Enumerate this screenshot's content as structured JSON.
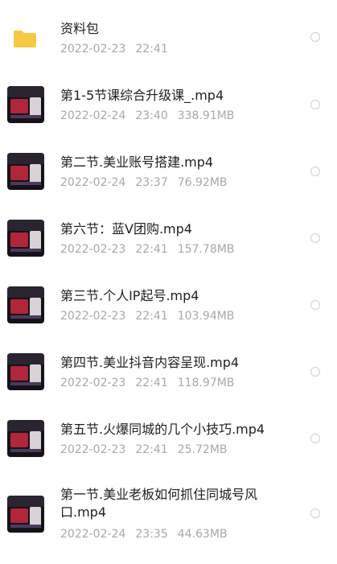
{
  "files": [
    {
      "name": "资料包",
      "date": "2022-02-23",
      "time": "22:41",
      "size": "",
      "type": "folder"
    },
    {
      "name": "第1-5节课综合升级课_.mp4",
      "date": "2022-02-24",
      "time": "23:40",
      "size": "338.91MB",
      "type": "video"
    },
    {
      "name": "第二节.美业账号搭建.mp4",
      "date": "2022-02-24",
      "time": "23:37",
      "size": "76.92MB",
      "type": "video"
    },
    {
      "name": "第六节：蓝V团购.mp4",
      "date": "2022-02-23",
      "time": "22:41",
      "size": "157.78MB",
      "type": "video"
    },
    {
      "name": "第三节.个人IP起号.mp4",
      "date": "2022-02-23",
      "time": "22:41",
      "size": "103.94MB",
      "type": "video"
    },
    {
      "name": "第四节.美业抖音内容呈现.mp4",
      "date": "2022-02-23",
      "time": "22:41",
      "size": "118.97MB",
      "type": "video"
    },
    {
      "name": "第五节.火爆同城的几个小技巧.mp4",
      "date": "2022-02-23",
      "time": "22:41",
      "size": "25.72MB",
      "type": "video"
    },
    {
      "name": "第一节.美业老板如何抓住同城号风口.mp4",
      "date": "2022-02-24",
      "time": "23:35",
      "size": "44.63MB",
      "type": "video"
    }
  ],
  "colors": {
    "folder": "#f6c945",
    "text": "#1f1f1f",
    "meta": "#a8a8a8"
  }
}
